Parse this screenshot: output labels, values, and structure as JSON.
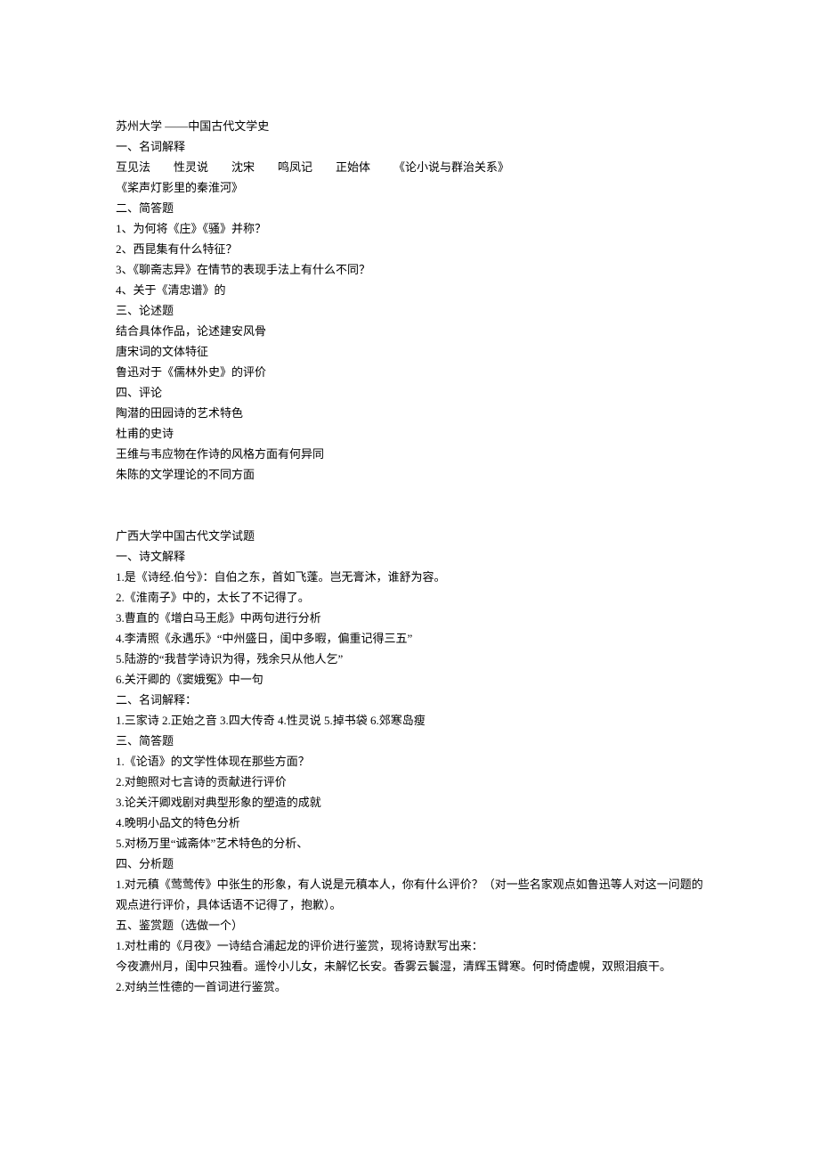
{
  "doc1": {
    "title": "苏州大学 ——中国古代文学史",
    "s1_heading": "一、名词解释",
    "s1_line1": "互见法        性灵说        沈宋        鸣凤记        正始体        《论小说与群治关系》",
    "s1_line2": "《桨声灯影里的秦淮河》",
    "s2_heading": "二、简答题",
    "s2_q1": "1、为何将《庄》《骚》并称？",
    "s2_q2": "2、西昆集有什么特征？",
    "s2_q3": "3、《聊斋志异》在情节的表现手法上有什么不同？",
    "s2_q4": "4、关于《清忠谱》的",
    "s3_heading": "三、论述题",
    "s3_q1": "结合具体作品，论述建安风骨",
    "s3_q2": "唐宋词的文体特征",
    "s3_q3": "鲁迅对于《儒林外史》的评价",
    "s4_heading": "四、评论",
    "s4_q1": "陶潜的田园诗的艺术特色",
    "s4_q2": "杜甫的史诗",
    "s4_q3": "王维与韦应物在作诗的风格方面有何异同",
    "s4_q4": "朱陈的文学理论的不同方面"
  },
  "doc2": {
    "title": "广西大学中国古代文学试题",
    "s1_heading": "一、诗文解释",
    "s1_q1": "1.是《诗经.伯兮》：自伯之东，首如飞蓬。岂无膏沐，谁舒为容。",
    "s1_q2": "2.《淮南子》中的，太长了不记得了。",
    "s1_q3": "3.曹直的《增白马王彪》中两句进行分析",
    "s1_q4": "4.李清照《永遇乐》“中州盛日，闺中多暇，偏重记得三五”",
    "s1_q5": "5.陆游的“我昔学诗识为得，残余只从他人乞”",
    "s1_q6": "6.关汗卿的《窦娥冤》中一句",
    "s2_heading": "二、名词解释：",
    "s2_line": "1.三家诗 2.正始之音 3.四大传奇 4.性灵说 5.掉书袋 6.郊寒岛瘦",
    "s3_heading": "三、简答题",
    "s3_q1": "1.《论语》的文学性体现在那些方面？",
    "s3_q2": "2.对鲍照对七言诗的贡献进行评价",
    "s3_q3": "3.论关汗卿戏剧对典型形象的塑造的成就",
    "s3_q4": "4.晚明小品文的特色分析",
    "s3_q5": "5.对杨万里“诚斋体”艺术特色的分析、",
    "s4_heading": "四、分析题",
    "s4_q1": "1.对元稹《莺莺传》中张生的形象，有人说是元稹本人，你有什么评价？（对一些名家观点如鲁迅等人对这一问题的观点进行评价，具体话语不记得了，抱歉）。",
    "s5_heading": "五、鉴赏题（选做一个）",
    "s5_q1a": "1.对杜甫的《月夜》一诗结合浦起龙的评价进行鉴赏，现将诗默写出来：",
    "s5_q1b": "今夜瀌州月，闺中只独看。遥怜小儿女，未解忆长安。香雾云鬟湿，清辉玉臂寒。何时倚虚幌，双照泪痕干。",
    "s5_q2": "2.对纳兰性德的一首词进行鉴赏。"
  }
}
